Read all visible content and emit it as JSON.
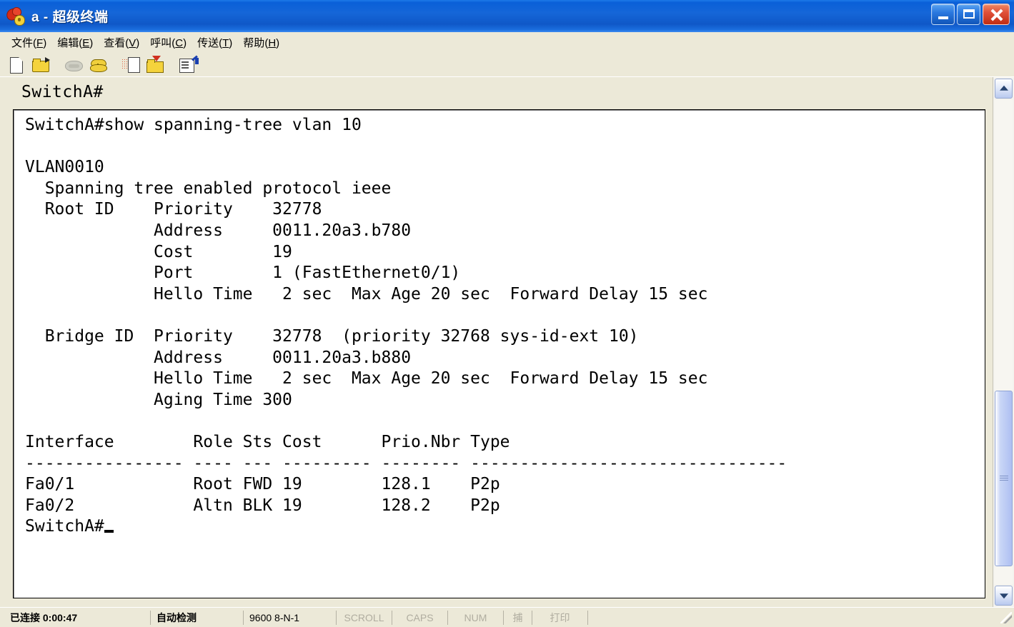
{
  "window": {
    "title": "a - 超级终端",
    "icon": "hyperterminal-icon",
    "controls": {
      "minimize": "minimize-button",
      "maximize": "maximize-button",
      "close": "close-button"
    }
  },
  "menu": {
    "items": [
      {
        "label": "文件",
        "accel": "F"
      },
      {
        "label": "编辑",
        "accel": "E"
      },
      {
        "label": "查看",
        "accel": "V"
      },
      {
        "label": "呼叫",
        "accel": "C"
      },
      {
        "label": "传送",
        "accel": "T"
      },
      {
        "label": "帮助",
        "accel": "H"
      }
    ]
  },
  "toolbar": {
    "buttons": [
      {
        "name": "new-connection-icon",
        "enabled": true
      },
      {
        "name": "open-connection-icon",
        "enabled": true
      },
      {
        "name": "disconnect-phone-icon",
        "enabled": false
      },
      {
        "name": "call-phone-icon",
        "enabled": true
      },
      {
        "name": "send-file-icon",
        "enabled": true
      },
      {
        "name": "receive-file-icon",
        "enabled": true
      },
      {
        "name": "properties-icon",
        "enabled": true
      }
    ]
  },
  "terminal": {
    "header_prompt": "SwitchA#",
    "cursor": "_",
    "content": "SwitchA#show spanning-tree vlan 10\n\nVLAN0010\n  Spanning tree enabled protocol ieee\n  Root ID    Priority    32778\n             Address     0011.20a3.b780\n             Cost        19\n             Port        1 (FastEthernet0/1)\n             Hello Time   2 sec  Max Age 20 sec  Forward Delay 15 sec\n\n  Bridge ID  Priority    32778  (priority 32768 sys-id-ext 10)\n             Address     0011.20a3.b880\n             Hello Time   2 sec  Max Age 20 sec  Forward Delay 15 sec\n             Aging Time 300\n\nInterface        Role Sts Cost      Prio.Nbr Type\n---------------- ---- --- --------- -------- --------------------------------\nFa0/1            Root FWD 19        128.1    P2p\nFa0/2            Altn BLK 19        128.2    P2p\n",
    "final_prompt": "SwitchA#",
    "command": "show spanning-tree vlan 10",
    "vlan": "VLAN0010",
    "protocol_line": "Spanning tree enabled protocol ieee",
    "root_id": {
      "priority": "32778",
      "address": "0011.20a3.b780",
      "cost": "19",
      "port": "1 (FastEthernet0/1)",
      "hello_time": "2 sec",
      "max_age": "20 sec",
      "forward_delay": "15 sec"
    },
    "bridge_id": {
      "priority": "32778",
      "priority_detail": "(priority 32768 sys-id-ext 10)",
      "address": "0011.20a3.b880",
      "hello_time": "2 sec",
      "max_age": "20 sec",
      "forward_delay": "15 sec",
      "aging_time": "300"
    },
    "table": {
      "headers": [
        "Interface",
        "Role",
        "Sts",
        "Cost",
        "Prio.Nbr",
        "Type"
      ],
      "rows": [
        [
          "Fa0/1",
          "Root",
          "FWD",
          "19",
          "128.1",
          "P2p"
        ],
        [
          "Fa0/2",
          "Altn",
          "BLK",
          "19",
          "128.2",
          "P2p"
        ]
      ]
    }
  },
  "scrollbar": {
    "up_arrow": "scroll-up-icon",
    "down_arrow": "scroll-down-icon"
  },
  "statusbar": {
    "connection": "已连接 0:00:47",
    "detect": "自动检测",
    "settings": "9600 8-N-1",
    "scroll": "SCROLL",
    "caps": "CAPS",
    "num": "NUM",
    "capture": "捕",
    "print": "打印"
  },
  "colors": {
    "titlebar": "#0a5fd4",
    "chrome": "#ece9d8",
    "terminal_bg": "#ffffff",
    "terminal_fg": "#000000",
    "close_button": "#c02c12"
  }
}
